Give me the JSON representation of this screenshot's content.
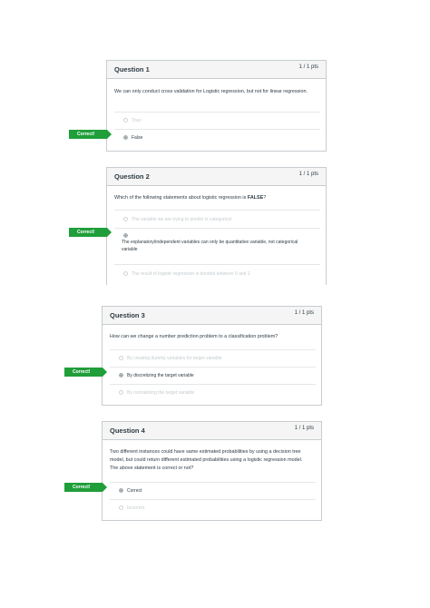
{
  "badge": "Correct!",
  "questions": [
    {
      "title": "Question 1",
      "points": "1 / 1 pts",
      "text": "We can only conduct cross validation for Logistic regression, but not for linear regression.",
      "answers": [
        "True",
        "False"
      ]
    },
    {
      "title": "Question 2",
      "points": "1 / 1 pts",
      "text_prefix": "Which of the following statements about logistic regression is ",
      "text_bold": "FALSE",
      "text_suffix": "?",
      "answers": [
        "The variable we are trying to predict is categorical",
        "The explanatory/independent variables can only be quantitative variable, not categorical variable",
        "The result of logistic regression is bonded between 0 and 1"
      ]
    },
    {
      "title": "Question 3",
      "points": "1 / 1 pts",
      "text": "How can we change a number prediction problem to a classification problem?",
      "answers": [
        "By creating dummy variables for target variable",
        "By discretizing the target variable",
        "By normalizing the target variable"
      ]
    },
    {
      "title": "Question 4",
      "points": "1 / 1 pts",
      "text": "Two different instances could have same estimated probabilities by using a decision tree model, but could return different estimated probabilities using a logistic regression model. The above statement is correct or not?",
      "answers": [
        "Correct",
        "Incorrect"
      ]
    }
  ]
}
